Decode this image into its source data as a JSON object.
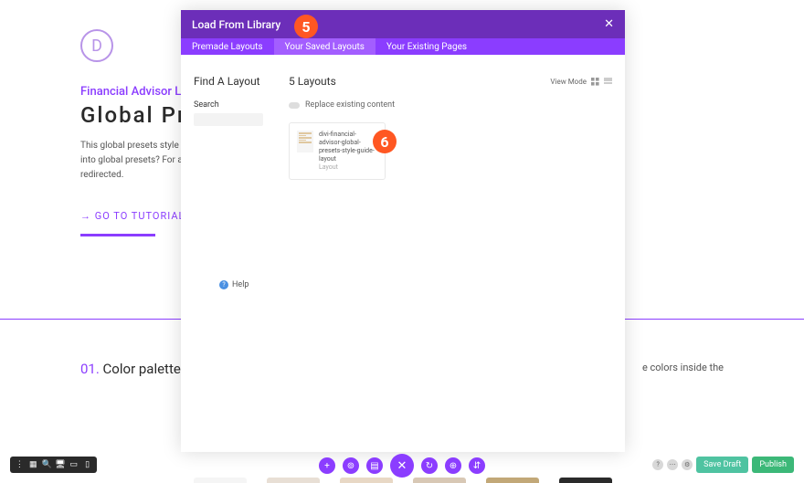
{
  "bg": {
    "logo_letter": "D",
    "subtitle": "Financial Advisor Layo",
    "title": "Global Prese",
    "body": "This global presets style guide is a modules into global presets? For a below to be redirected.",
    "link_label": "→ GO TO TUTORIAL",
    "section_num": "01.",
    "section_label": " Color palette",
    "side_text": "e colors inside the"
  },
  "modal": {
    "title": "Load From Library",
    "tabs": {
      "premade": "Premade Layouts",
      "saved": "Your Saved Layouts",
      "existing": "Your Existing Pages"
    },
    "sidebar": {
      "title": "Find A Layout",
      "search_label": "Search",
      "help": "Help"
    },
    "main": {
      "title": "5 Layouts",
      "view_mode": "View Mode",
      "replace_label": "Replace existing content",
      "card": {
        "name": "divi-financial-advisor-global-presets-style-guide-layout",
        "type": "Layout"
      }
    }
  },
  "circles": {
    "five": "5",
    "six": "6"
  },
  "bottom_right": {
    "save_draft": "Save Draft",
    "publish": "Publish"
  },
  "swatches": [
    "#f5f5f5",
    "#e8dfd5",
    "#e8d8c5",
    "#d8c8b5",
    "#c2a878",
    "#2a2a2a"
  ]
}
